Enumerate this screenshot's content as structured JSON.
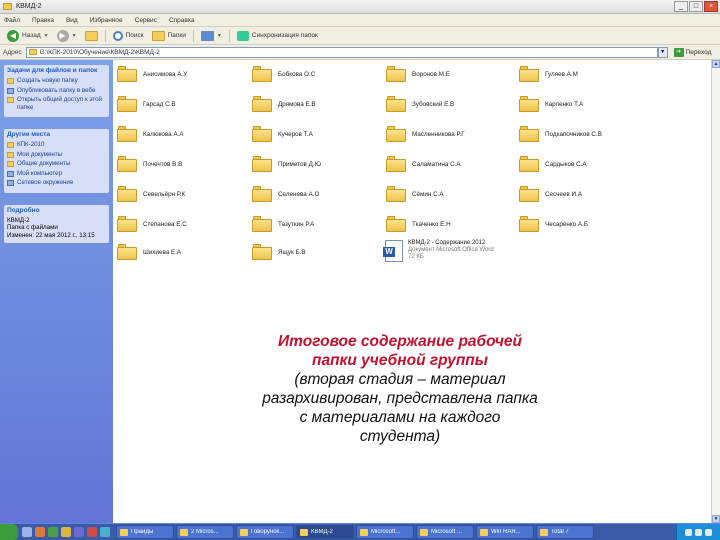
{
  "window": {
    "title": "КВМД-2"
  },
  "menubar": [
    "Файл",
    "Правка",
    "Вид",
    "Избранное",
    "Сервис",
    "Справка"
  ],
  "toolbar": {
    "back_label": "Назад",
    "search_label": "Поиск",
    "folders_label": "Папки",
    "sync_label": "Синхронизация папок"
  },
  "addressbar": {
    "label": "Адрес",
    "path": "G:\\КПК-2010\\Обучение\\КВМД-2\\КВМД-2",
    "go_label": "Переход"
  },
  "sidebar": {
    "tasks": {
      "title": "Задачи для файлов и папок",
      "items": [
        "Создать новую папку",
        "Опубликовать папку в вебе",
        "Открыть общий доступ к этой папке"
      ]
    },
    "places": {
      "title": "Другие места",
      "items": [
        "КПК-2010",
        "Мои документы",
        "Общие документы",
        "Мой компьютер",
        "Сетевое окружение"
      ]
    },
    "details": {
      "title": "Подробно",
      "lines": [
        "КВМД-2",
        "Папка с файлами",
        "Изменен: 22 мая 2012 г., 13:15"
      ]
    }
  },
  "folders": [
    [
      "Анисимова А.У",
      "Бобкова О.С",
      "Воронов М.Е",
      "Гуляев А.М"
    ],
    [
      "Гарсад С.В",
      "Дрямова Е.В",
      "Зубовский Е.В",
      "Карпенко Т.А"
    ],
    [
      "Калюкова А.А",
      "Кучеров Т.А",
      "Масленникова Р.Г",
      "Подкапочников С.В"
    ],
    [
      "Почечтов В.В",
      "Приметов Д.Ю",
      "Саламатина С.А",
      "Сардыков С.А"
    ],
    [
      "Севельёрн Р.К",
      "Селенева А.О",
      "Сёмин С.А",
      "Сесчеев И.А"
    ],
    [
      "Степанова Е.С",
      "Тазуткин Р.А",
      "Ткаченко Е.Н",
      "Чесаренко А.Б"
    ],
    [
      "Шихиева Е.А",
      "Ящук Б.В"
    ]
  ],
  "document": {
    "name": "КВМД-2 - Содержание 2012",
    "type": "Документ Microsoft Office Word",
    "size": "72 КБ"
  },
  "caption": {
    "highlight_lines": [
      "Итоговое содержание рабочей",
      "папки учебной группы"
    ],
    "normal_lines": [
      "(вторая стадия – материал",
      "разархивирован, представлена папка",
      "с материалами на каждого",
      "студента)"
    ]
  },
  "taskbar": {
    "tasks": [
      "Прайды",
      "2 Micros...",
      "Говорунок...",
      "КВМД-2",
      "Microsoft...",
      "Microsoft ...",
      "Win RAR...",
      "Total 7"
    ]
  },
  "colors": {
    "caption_highlight": "#c4122e",
    "sidebar_top": "#7ba2e7",
    "sidebar_bottom": "#6375d6"
  }
}
